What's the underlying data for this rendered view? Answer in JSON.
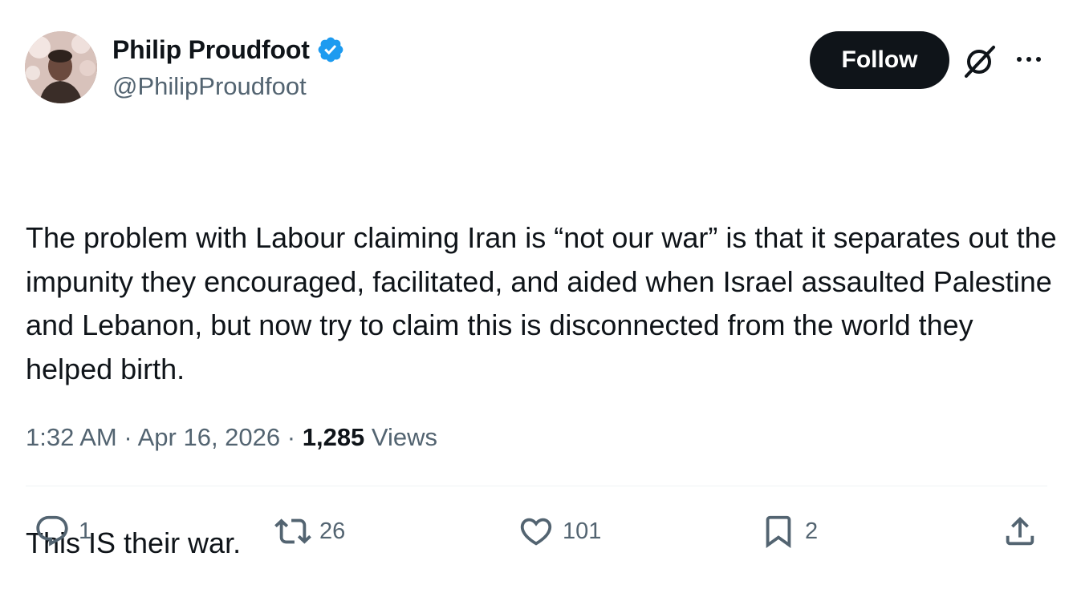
{
  "author": {
    "display_name": "Philip Proudfoot",
    "handle": "@PhilipProudfoot",
    "verified": true,
    "verified_color": "#1d9bf0"
  },
  "header_actions": {
    "follow_label": "Follow",
    "grok_icon": "grok-icon",
    "more_icon": "more-horizontal-icon"
  },
  "tweet": {
    "paragraphs": [
      "The problem with Labour claiming Iran is “not our war” is that it separates out the impunity they encouraged, facilitated, and aided when Israel assaulted Palestine and Lebanon, but now try to claim this is disconnected from the world they helped birth.",
      "This IS their war."
    ]
  },
  "meta": {
    "time": "1:32 AM",
    "separator": "·",
    "date": "Apr 16, 2026",
    "views_count": "1,285",
    "views_label": "Views"
  },
  "engagement": {
    "replies": "1",
    "reposts": "26",
    "likes": "101",
    "bookmarks": "2"
  },
  "colors": {
    "text_primary": "#0f1419",
    "text_secondary": "#536471",
    "divider": "#eff3f4",
    "follow_bg": "#0f1419"
  }
}
